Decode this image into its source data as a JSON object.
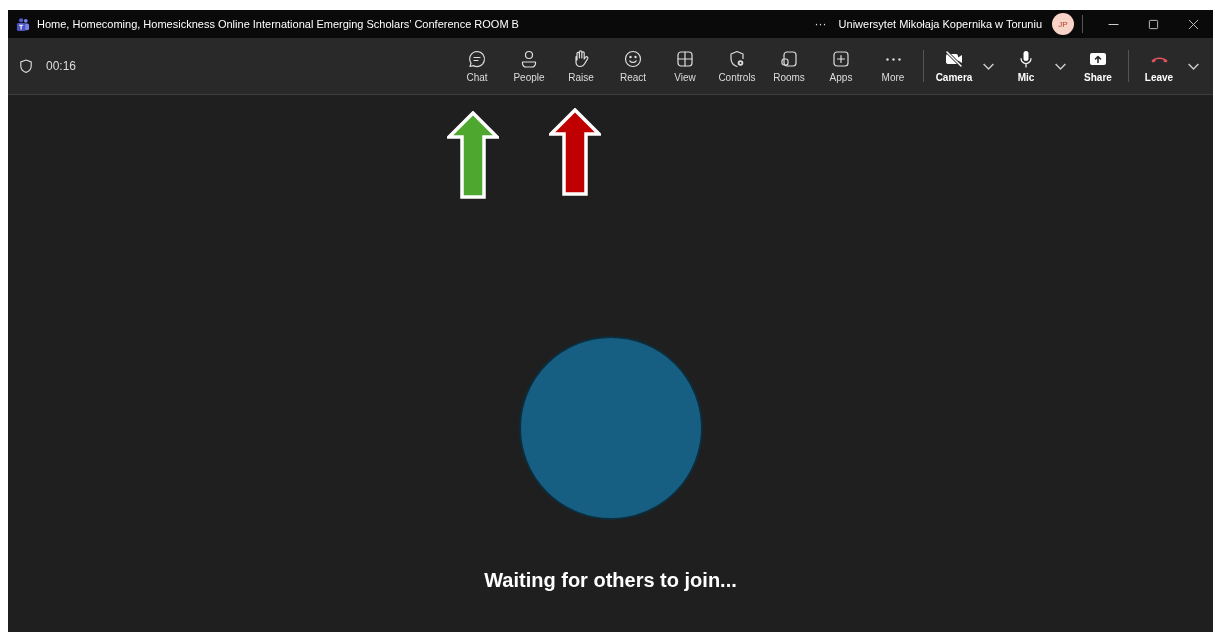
{
  "window": {
    "title": "Home, Homecoming, Homesickness  Online International Emerging Scholars’ Conference ROOM B",
    "more": "···",
    "organization": "Uniwersytet Mikołaja Kopernika w Toruniu",
    "avatar": "JP"
  },
  "meeting": {
    "timer": "00:16"
  },
  "actions": [
    {
      "kind": "chat",
      "label": "Chat"
    },
    {
      "kind": "people",
      "label": "People"
    },
    {
      "kind": "raise",
      "label": "Raise"
    },
    {
      "kind": "react",
      "label": "React"
    },
    {
      "kind": "view",
      "label": "View"
    },
    {
      "kind": "controls",
      "label": "Controls"
    },
    {
      "kind": "rooms",
      "label": "Rooms"
    },
    {
      "kind": "apps",
      "label": "Apps"
    },
    {
      "kind": "more",
      "label": "More"
    }
  ],
  "media": [
    {
      "kind": "camera",
      "label": "Camera",
      "dropdown": true
    },
    {
      "kind": "mic",
      "label": "Mic",
      "dropdown": true
    },
    {
      "kind": "share",
      "label": "Share",
      "dropdown": false
    }
  ],
  "leave": {
    "label": "Leave",
    "dropdown": true
  },
  "stage": {
    "message": "Waiting for others to join..."
  },
  "annotations": [
    {
      "kind": "arrow",
      "color": "#4ea72e"
    },
    {
      "kind": "arrow",
      "color": "#c00000"
    }
  ]
}
